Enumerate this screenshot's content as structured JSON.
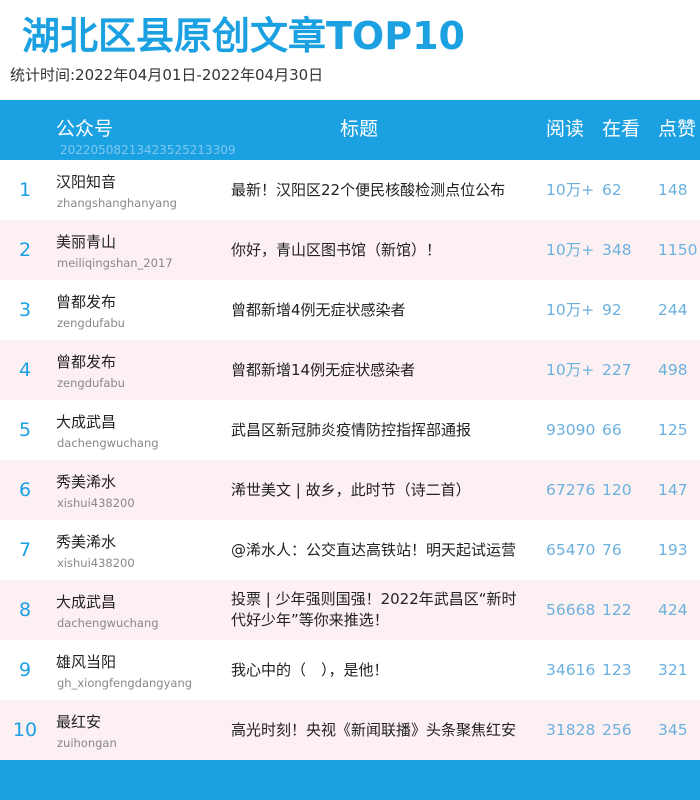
{
  "title": "湖北区县原创文章TOP10",
  "period": "统计时间:2022年04月01日-2022年04月30日",
  "header": {
    "account": "公众号",
    "article_title": "标题",
    "read": "阅读",
    "watch": "在看",
    "like": "点赞",
    "serial": "20220508213423525213309"
  },
  "colors": {
    "accent": "#1ba0e1",
    "alt_row": "#fcf0f2",
    "number": "#6cb1de"
  },
  "rows": [
    {
      "rank": "1",
      "name": "汉阳知音",
      "id": "zhangshanghanyang",
      "title": "最新！汉阳区22个便民核酸检测点位公布",
      "read": "10万+",
      "watch": "62",
      "like": "148"
    },
    {
      "rank": "2",
      "name": "美丽青山",
      "id": "meiliqingshan_2017",
      "title": "你好，青山区图书馆（新馆）！",
      "read": "10万+",
      "watch": "348",
      "like": "1150"
    },
    {
      "rank": "3",
      "name": "曾都发布",
      "id": "zengdufabu",
      "title": "曾都新增4例无症状感染者",
      "read": "10万+",
      "watch": "92",
      "like": "244"
    },
    {
      "rank": "4",
      "name": "曾都发布",
      "id": "zengdufabu",
      "title": "曾都新增14例无症状感染者",
      "read": "10万+",
      "watch": "227",
      "like": "498"
    },
    {
      "rank": "5",
      "name": "大成武昌",
      "id": "dachengwuchang",
      "title": "武昌区新冠肺炎疫情防控指挥部通报",
      "read": "93090",
      "watch": "66",
      "like": "125"
    },
    {
      "rank": "6",
      "name": "秀美浠水",
      "id": "xishui438200",
      "title": "浠世美文 | 故乡，此时节（诗二首）",
      "read": "67276",
      "watch": "120",
      "like": "147"
    },
    {
      "rank": "7",
      "name": "秀美浠水",
      "id": "xishui438200",
      "title": "@浠水人：公交直达高铁站！明天起试运营",
      "read": "65470",
      "watch": "76",
      "like": "193"
    },
    {
      "rank": "8",
      "name": "大成武昌",
      "id": "dachengwuchang",
      "title": "投票 | 少年强则国强！2022年武昌区“新时代好少年”等你来推选！",
      "read": "56668",
      "watch": "122",
      "like": "424"
    },
    {
      "rank": "9",
      "name": "雄风当阳",
      "id": "gh_xiongfengdangyang",
      "title": "我心中的（　），是他！",
      "read": "34616",
      "watch": "123",
      "like": "321"
    },
    {
      "rank": "10",
      "name": "最红安",
      "id": "zuihongan",
      "title": "高光时刻！央视《新闻联播》头条聚焦红安",
      "read": "31828",
      "watch": "256",
      "like": "345"
    }
  ]
}
